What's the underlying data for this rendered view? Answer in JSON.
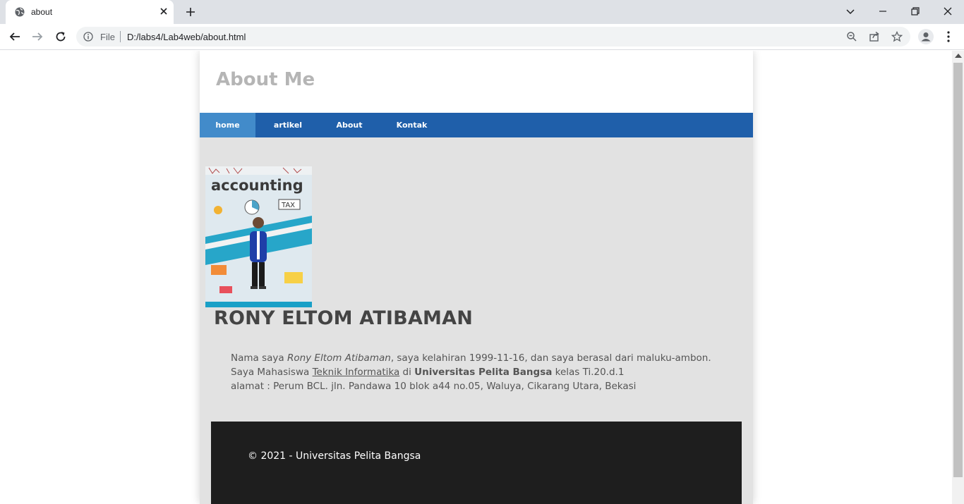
{
  "browser": {
    "tab_title": "about",
    "url_scheme": "File",
    "url": "D:/labs4/Lab4web/about.html"
  },
  "site": {
    "header_title": "About Me",
    "nav": [
      {
        "label": "home",
        "active": true
      },
      {
        "label": "artikel",
        "active": false
      },
      {
        "label": "About",
        "active": false
      },
      {
        "label": "Kontak",
        "active": false
      }
    ],
    "photo_text": {
      "heading": "accounting",
      "tax": "TAX"
    },
    "profile_name": "RONY ELTOM ATIBAMAN",
    "bio": {
      "line1_prefix": "Nama saya ",
      "line1_name": "Rony Eltom Atibaman",
      "line1_suffix": ", saya kelahiran 1999-11-16, dan saya berasal dari maluku-ambon.",
      "line2_prefix": "Saya Mahasiswa ",
      "line2_major": "Teknik Informatika",
      "line2_mid": " di ",
      "line2_university": "Universitas Pelita Bangsa",
      "line2_suffix": " kelas Ti.20.d.1",
      "line3": "alamat : Perum BCL. jln. Pandawa 10 blok a44 no.05, Waluya, Cikarang Utara, Bekasi"
    },
    "footer_text": "© 2021 - Universitas Pelita Bangsa"
  },
  "colors": {
    "nav_bg": "#1f5faa",
    "nav_active": "#428bca",
    "content_bg": "#e2e2e2",
    "footer_bg": "#1e1e1e"
  }
}
